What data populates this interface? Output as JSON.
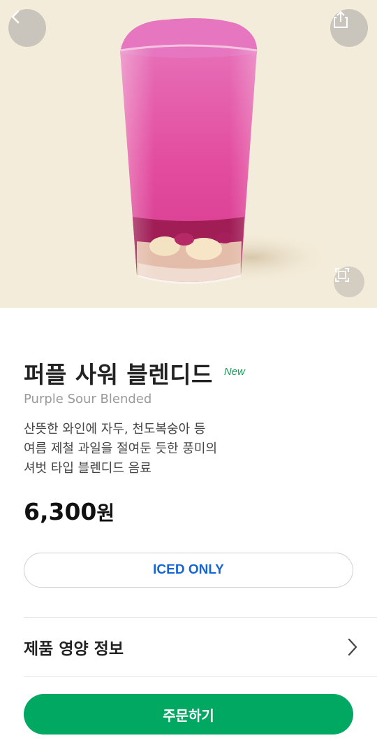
{
  "header": {
    "back_icon": "chevron-left-icon",
    "share_icon": "share-icon",
    "zoom_icon": "expand-icon"
  },
  "product": {
    "name_ko": "퍼플 사워 블렌디드",
    "badge": "New",
    "name_en": "Purple Sour Blended",
    "description_lines": [
      "산뜻한 와인에 자두, 천도복숭아 등",
      "여름 제철 과일을 절여둔 듯한 풍미의",
      "셔벗 타입 블렌디드 음료"
    ],
    "price": "6,300",
    "price_unit": "원",
    "temperature_option": "ICED ONLY"
  },
  "nutrition": {
    "label": "제품 영양 정보"
  },
  "order": {
    "label": "주문하기"
  },
  "colors": {
    "brand_green": "#00a862",
    "badge_green": "#1a9e5a",
    "iced_blue": "#1565d6",
    "hero_bg": "#f4ecda",
    "drink_pink": "#e44fa4"
  }
}
